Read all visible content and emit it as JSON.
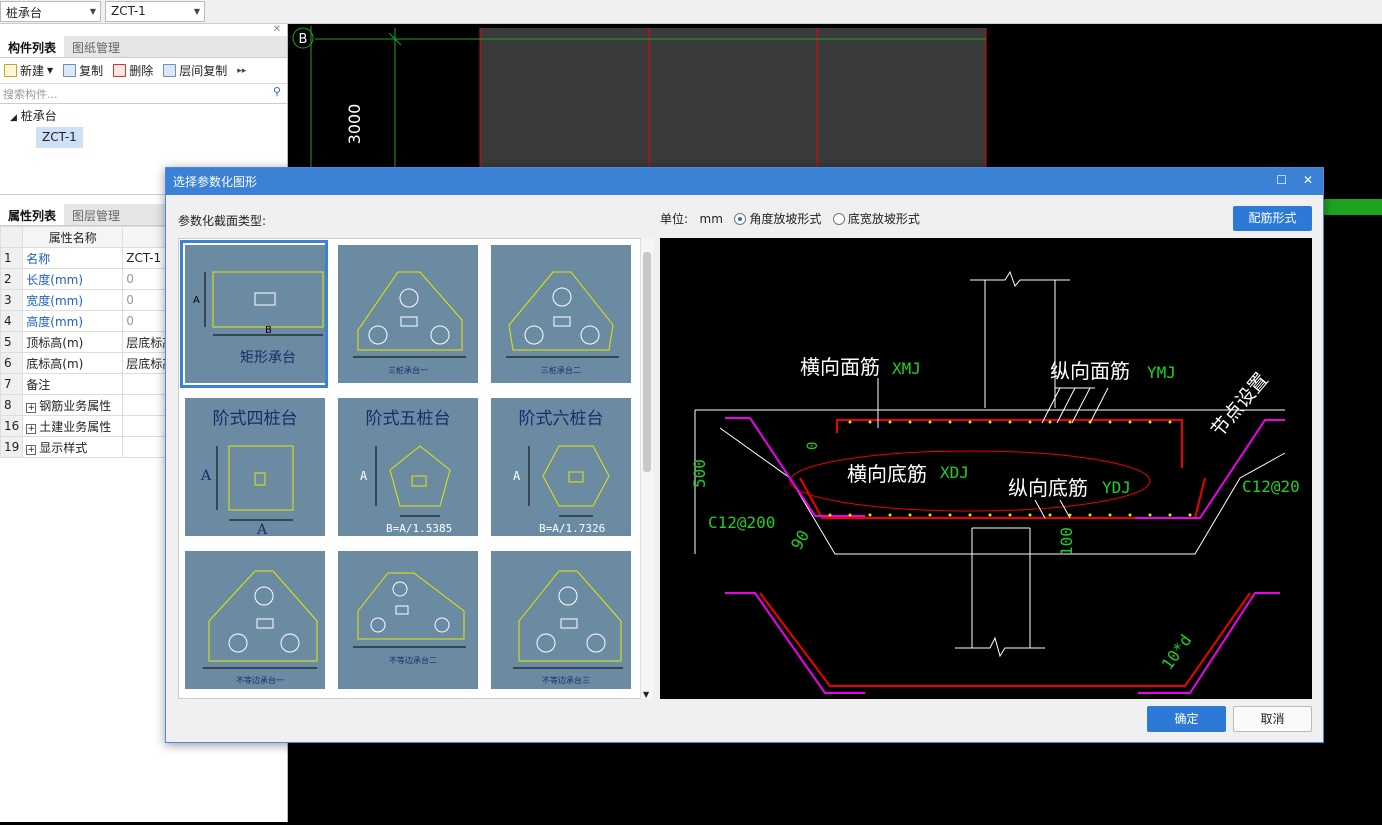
{
  "topbar": {
    "type_combo": "桩承台",
    "name_combo": "ZCT-1"
  },
  "component_panel": {
    "tabs": [
      "构件列表",
      "图纸管理"
    ],
    "toolbar": {
      "new": "新建",
      "copy": "复制",
      "delete": "删除",
      "floor_copy": "层间复制"
    },
    "search_placeholder": "搜索构件...",
    "tree": {
      "group": "桩承台",
      "item": "ZCT-1"
    }
  },
  "property_panel": {
    "tabs": [
      "属性列表",
      "图层管理"
    ],
    "header": "属性名称",
    "rows": [
      {
        "num": "1",
        "name": "名称",
        "value": "ZCT-1"
      },
      {
        "num": "2",
        "name": "长度(mm)",
        "value": "0"
      },
      {
        "num": "3",
        "name": "宽度(mm)",
        "value": "0"
      },
      {
        "num": "4",
        "name": "高度(mm)",
        "value": "0"
      },
      {
        "num": "5",
        "name": "顶标高(m)",
        "value": "层底标高"
      },
      {
        "num": "6",
        "name": "底标高(m)",
        "value": "层底标高"
      },
      {
        "num": "7",
        "name": "备注",
        "value": ""
      },
      {
        "num": "8",
        "name": "钢筋业务属性",
        "value": ""
      },
      {
        "num": "16",
        "name": "土建业务属性",
        "value": ""
      },
      {
        "num": "19",
        "name": "显示样式",
        "value": ""
      }
    ]
  },
  "cad": {
    "axis_label": "B",
    "dimension": "3000"
  },
  "dialog": {
    "title": "选择参数化图形",
    "section_label": "参数化截面类型:",
    "unit_label": "单位:",
    "unit_value": "mm",
    "radio_angle": "角度放坡形式",
    "radio_width": "底宽放坡形式",
    "rebar_button": "配筋形式",
    "ok": "确定",
    "cancel": "取消",
    "shapes": [
      {
        "label": "矩形承台",
        "dim1": "A",
        "dim2": "B"
      },
      {
        "label": "三桩承台一"
      },
      {
        "label": "三桩承台二"
      },
      {
        "label": "阶式四桩台",
        "dim1": "A",
        "dim2": "A"
      },
      {
        "label": "阶式五桩台",
        "dim1": "A",
        "dim2": "B=A/1.5385"
      },
      {
        "label": "阶式六桩台",
        "dim1": "A",
        "dim2": "B=A/1.7326"
      },
      {
        "label": "不等边承台一"
      },
      {
        "label": "不等边承台二"
      },
      {
        "label": "不等边承台三"
      }
    ],
    "preview": {
      "xmj_label": "横向面筋",
      "xmj_code": "XMJ",
      "ymj_label": "纵向面筋",
      "ymj_code": "YMJ",
      "xdj_label": "横向底筋",
      "xdj_code": "XDJ",
      "ydj_label": "纵向底筋",
      "ydj_code": "YDJ",
      "node": "节点设置",
      "rebar_left": "C12@200",
      "rebar_right": "C12@20",
      "h500": "500",
      "zero": "0",
      "angle": "90",
      "h100": "100",
      "lap": "10*d"
    }
  }
}
